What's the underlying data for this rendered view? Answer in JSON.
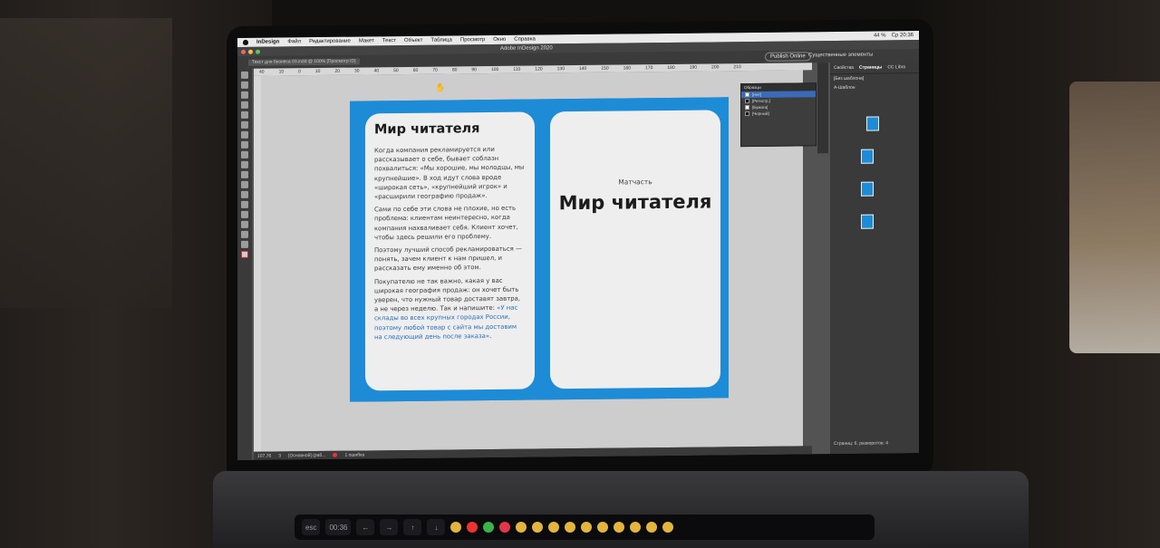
{
  "menubar": {
    "app": "InDesign",
    "items": [
      "Файл",
      "Редактирование",
      "Макет",
      "Текст",
      "Объект",
      "Таблица",
      "Просмотр",
      "Окно",
      "Справка"
    ],
    "battery": "44 %",
    "clock": "Ср 20:36"
  },
  "titlebar": {
    "title": "Adobe InDesign 2020"
  },
  "appbar": {
    "publish_label": "Publish Online",
    "workspace_label": "Существенные элементы"
  },
  "document": {
    "tab_label": "Текст для бизнеса 03.indd @ 100% [Просмотр ID]"
  },
  "ruler": {
    "ticks": [
      "40",
      "10",
      "0",
      "10",
      "20",
      "30",
      "40",
      "50",
      "60",
      "70",
      "80",
      "90",
      "100",
      "110",
      "120",
      "130",
      "140",
      "150",
      "160",
      "170",
      "180",
      "190",
      "200",
      "210"
    ]
  },
  "page_left": {
    "heading": "Мир читателя",
    "paragraphs": [
      "Когда компания рекламируется или рассказывает о себе, бывает соблазн похвалиться: «Мы хорошие, мы молодцы, мы крупнейшие». В ход идут слова вроде «широкая сеть», «крупнейший игрок» и «расширили географию продаж».",
      "Сами по себе эти слова не плохие, но есть проблема: клиентам неинтересно, когда компания нахваливает себя. Клиент хочет, чтобы здесь решили его проблему.",
      "Поэтому лучший способ рекламироваться — понять, зачем клиент к нам пришел, и рассказать ему именно об этом."
    ],
    "last_paragraph_prefix": "Покупателю не так важно, какая у вас широкая география продаж: он хочет быть уверен, что нужный товар доставят завтра, а не через неделю. Так и напишите: ",
    "last_paragraph_link": "«У нас склады во всех крупных городах России, поэтому любой товар с сайта мы доставим на следующий день после заказа»",
    "last_paragraph_suffix": "."
  },
  "page_right": {
    "label": "Матчасть",
    "title": "Мир читателя"
  },
  "swatches_panel": {
    "title": "Образцы",
    "rows": [
      "[Нет]",
      "[Регистр.]",
      "[Бумага]",
      "[Черный]"
    ]
  },
  "pages_panel": {
    "tabs": [
      "Свойства",
      "Страницы",
      "CC Libra"
    ],
    "rows": [
      "[Без шаблона]",
      "А-Шаблон"
    ],
    "footer": "Страниц: 6, разворотов: 4"
  },
  "statusbar": {
    "zoom": "107,76",
    "page": "3",
    "style": "[Основной] (раб...",
    "errors": "1 ошибка"
  },
  "touchbar": {
    "esc": "esc",
    "time": "00:36"
  }
}
